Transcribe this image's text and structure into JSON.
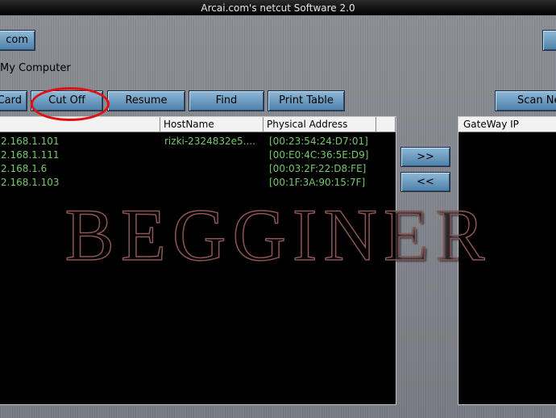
{
  "window": {
    "title": "Arcai.com's netcut Software 2.0"
  },
  "toolbar_top": {
    "com_button": "com"
  },
  "adapter": {
    "label": "My Computer"
  },
  "actions": {
    "card": "Card",
    "cut_off": "Cut Off",
    "resume": "Resume",
    "find": "Find",
    "print_table": "Print Table",
    "scan": "Scan Ne"
  },
  "hosts_table": {
    "columns": [
      "",
      "HostName",
      "Physical Address"
    ],
    "rows": [
      {
        "ip": "2.168.1.101",
        "hostname": "rizki-2324832e5....",
        "mac": "[00:23:54:24:D7:01]"
      },
      {
        "ip": "2.168.1.111",
        "hostname": "",
        "mac": "[00:E0:4C:36:5E:D9]"
      },
      {
        "ip": "2.168.1.6",
        "hostname": "",
        "mac": "[00:03:2F:22:D8:FE]"
      },
      {
        "ip": "2.168.1.103",
        "hostname": "",
        "mac": "[00:1F:3A:90:15:7F]"
      }
    ]
  },
  "transfer": {
    "add": ">>",
    "remove": "<<"
  },
  "gateway_table": {
    "header": "GateWay IP"
  },
  "overlay": {
    "watermark": "BEGGINER"
  },
  "colors": {
    "row_text": "#74c96b",
    "button_top": "#8fb9d8",
    "button_bottom": "#4d7fa8",
    "highlight_circle": "#e01010"
  }
}
